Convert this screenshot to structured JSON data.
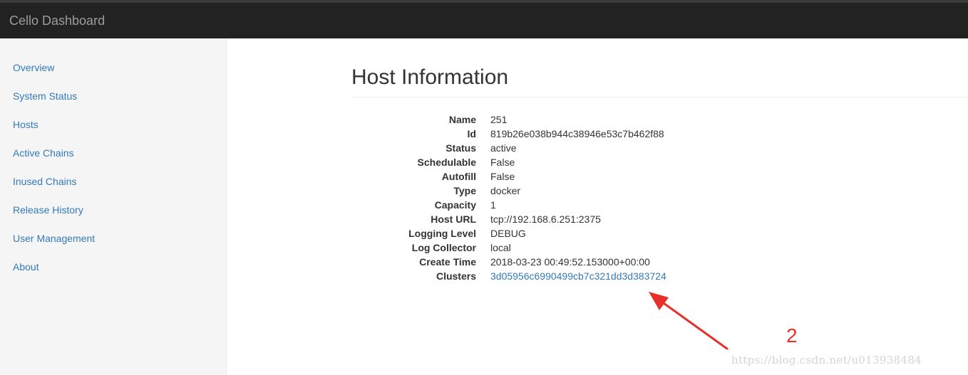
{
  "navbar": {
    "brand": "Cello Dashboard"
  },
  "sidebar": {
    "items": [
      {
        "label": "Overview"
      },
      {
        "label": "System Status"
      },
      {
        "label": "Hosts"
      },
      {
        "label": "Active Chains"
      },
      {
        "label": "Inused Chains"
      },
      {
        "label": "Release History"
      },
      {
        "label": "User Management"
      },
      {
        "label": "About"
      }
    ]
  },
  "main": {
    "title": "Host Information",
    "fields": [
      {
        "label": "Name",
        "value": "251"
      },
      {
        "label": "Id",
        "value": "819b26e038b944c38946e53c7b462f88"
      },
      {
        "label": "Status",
        "value": "active"
      },
      {
        "label": "Schedulable",
        "value": "False"
      },
      {
        "label": "Autofill",
        "value": "False"
      },
      {
        "label": "Type",
        "value": "docker"
      },
      {
        "label": "Capacity",
        "value": "1"
      },
      {
        "label": "Host URL",
        "value": "tcp://192.168.6.251:2375"
      },
      {
        "label": "Logging Level",
        "value": "DEBUG"
      },
      {
        "label": "Log Collector",
        "value": "local"
      },
      {
        "label": "Create Time",
        "value": "2018-03-23 00:49:52.153000+00:00"
      },
      {
        "label": "Clusters",
        "value": "3d05956c6990499cb7c321dd3d383724",
        "link": true
      }
    ]
  },
  "annotation": {
    "number": "2",
    "color": "#e8302a"
  },
  "watermark": "https://blog.csdn.net/u013938484"
}
